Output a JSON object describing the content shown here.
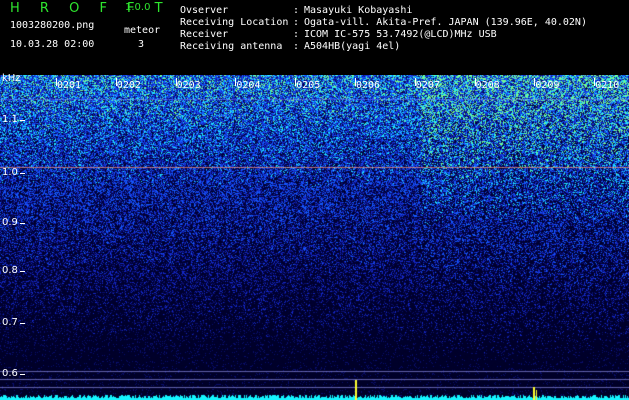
{
  "header": {
    "app_title": "H R O F F T",
    "version": "1.0.0",
    "filename": "1003280200.png",
    "datetime": "10.03.28 02:00",
    "meteor_label": "meteor",
    "meteor_count": "3"
  },
  "info": {
    "rows": [
      {
        "label": "Ovserver",
        "value": "Masayuki Kobayashi"
      },
      {
        "label": "Receiving Location",
        "value": "Ogata-vill. Akita-Pref. JAPAN (139.96E, 40.02N)"
      },
      {
        "label": "Receiver",
        "value": "ICOM IC-575 53.7492(@LCD)MHz USB"
      },
      {
        "label": "Receiving antenna",
        "value": "A504HB(yagi 4el)"
      }
    ],
    "colon": ":"
  },
  "axis": {
    "y_unit": "kHz",
    "y_ticks": [
      "1.1",
      "1.0",
      "0.9",
      "0.8",
      "0.7",
      "0.6"
    ],
    "x_ticks": [
      "0201",
      "0202",
      "0203",
      "0204",
      "0205",
      "0206",
      "0207",
      "0208",
      "0209",
      "0210"
    ]
  },
  "colors": {
    "title_green": "#2ee62e",
    "text_white": "#ffffff",
    "background": "#000000",
    "noise_blue": "#1d33ff",
    "noise_cyan": "#2ef0ff",
    "baseline_cyan": "#15f5ff",
    "meteor_yellow": "#ffff30"
  }
}
